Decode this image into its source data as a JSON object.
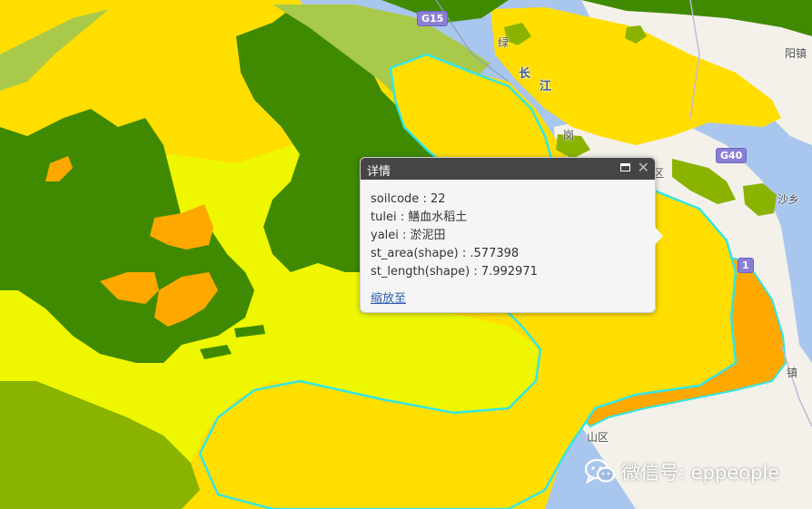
{
  "popup": {
    "title": "详情",
    "fields": [
      {
        "key": "soilcode",
        "sep": " : ",
        "value": "22"
      },
      {
        "key": "tulei",
        "sep": " : ",
        "value": "鳝血水稻土"
      },
      {
        "key": "yalei",
        "sep": " : ",
        "value": "淤泥田"
      },
      {
        "key": "st_area(shape)",
        "sep": " : ",
        "value": ".577398"
      },
      {
        "key": "st_length(shape)",
        "sep": " : ",
        "value": "7.992971"
      }
    ],
    "zoom_link": "缩放至",
    "icons": {
      "maximize": "maximize-icon",
      "close": "close-icon"
    }
  },
  "map": {
    "labels": {
      "river_chang": "长",
      "river_jiang": "江",
      "town_lv": "绿",
      "town_yang": "阳镇",
      "town_shaxiang": "沙乡",
      "town_zhen": "镇",
      "district_qu": "区",
      "district_shanqu": "山区",
      "partial_tu": "岗"
    },
    "shields": {
      "g15": "G15",
      "g40": "G40",
      "partial_1": "1"
    },
    "colors": {
      "water": "#a9c6ee",
      "land": "#f4f1ea",
      "yellow_soil": "#ffde00",
      "lime_soil": "#eef700",
      "dark_green_soil": "#3f8a00",
      "olive_soil": "#8ab300",
      "light_olive_soil": "#a9c94a",
      "orange_soil": "#ffa800",
      "highlight_outline": "#33e6e6"
    }
  },
  "watermark": {
    "text": "微信号: eppeople",
    "icon": "wechat-icon"
  }
}
